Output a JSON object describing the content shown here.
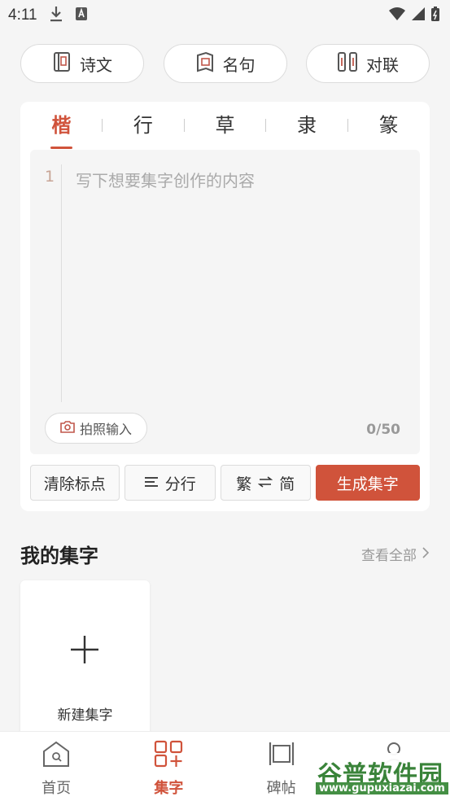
{
  "status_bar": {
    "time": "4:11"
  },
  "categories": [
    {
      "label": "诗文",
      "icon": "book-icon"
    },
    {
      "label": "名句",
      "icon": "quote-book-icon"
    },
    {
      "label": "对联",
      "icon": "couplet-icon"
    }
  ],
  "script_tabs": {
    "items": [
      "楷",
      "行",
      "草",
      "隶",
      "篆"
    ],
    "active": "楷"
  },
  "editor": {
    "line_number": "1",
    "placeholder": "写下想要集字创作的内容",
    "photo_input_label": "拍照输入",
    "counter": "0/50"
  },
  "actions": {
    "clear_punct": "清除标点",
    "split_lines": "分行",
    "trad": "繁",
    "simp": "简",
    "generate": "生成集字"
  },
  "my_collection": {
    "title": "我的集字",
    "view_all": "查看全部",
    "new_label": "新建集字"
  },
  "bottom_nav": [
    {
      "label": "首页",
      "icon": "home-icon",
      "active": false
    },
    {
      "label": "集字",
      "icon": "grid-plus-icon",
      "active": true
    },
    {
      "label": "碑帖",
      "icon": "scroll-icon",
      "active": false
    }
  ],
  "watermark": {
    "text": "谷普软件园",
    "url": "www.gupuxiazai.com"
  },
  "colors": {
    "accent": "#d0533b",
    "background": "#f5f5f5"
  }
}
